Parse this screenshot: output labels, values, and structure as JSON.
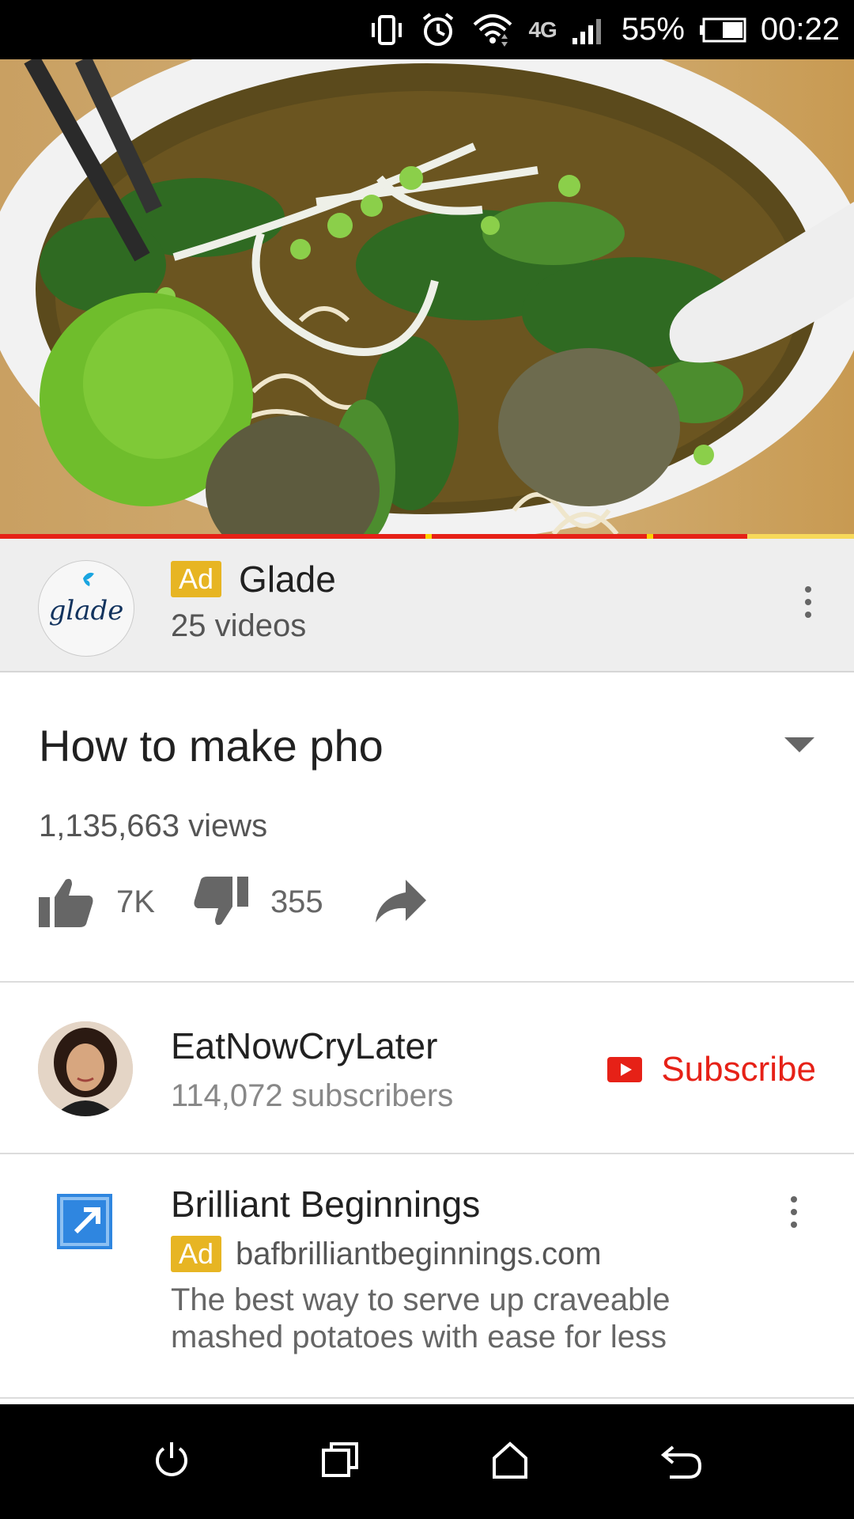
{
  "status_bar": {
    "network": "4G",
    "battery": "55%",
    "time": "00:22",
    "icons": [
      "vibrate-icon",
      "alarm-icon",
      "wifi-icon",
      "signal-icon",
      "battery-icon"
    ]
  },
  "video": {
    "progress_percent": 87.5,
    "ad_markers": [
      "yellow",
      "yellow"
    ]
  },
  "ad_channel": {
    "badge": "Ad",
    "name": "Glade",
    "meta": "25 videos",
    "logo_text": "glade"
  },
  "video_info": {
    "title": "How to make pho",
    "views": "1,135,663 views",
    "likes": "7K",
    "dislikes": "355"
  },
  "channel": {
    "name": "EatNowCryLater",
    "subscribers": "114,072 subscribers",
    "subscribe_label": "Subscribe"
  },
  "ad_card": {
    "title": "Brilliant Beginnings",
    "badge": "Ad",
    "url": "bafbrilliantbeginnings.com",
    "description": "The best way to serve up craveable mashed potatoes with ease for less"
  },
  "colors": {
    "accent_red": "#e62117",
    "ad_yellow": "#e7b523",
    "link_blue": "#2f86e0"
  }
}
